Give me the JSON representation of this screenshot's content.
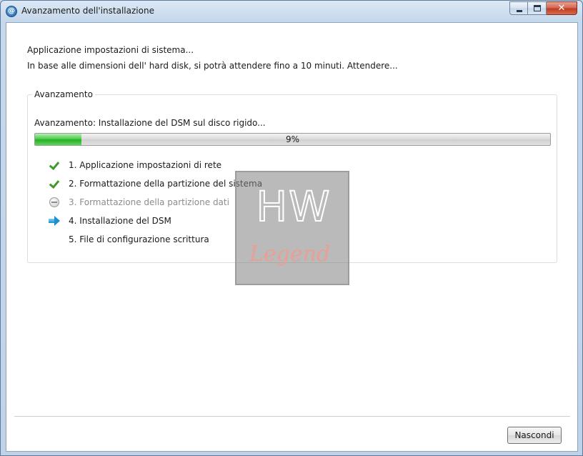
{
  "window": {
    "title": "Avanzamento dell'installazione",
    "close_glyph": "✕"
  },
  "message": {
    "line1": "Applicazione impostazioni di sistema...",
    "line2": "In base alle dimensioni dell' hard disk, si potrà attendere fino a 10 minuti. Attendere..."
  },
  "progress_group": {
    "legend": "Avanzamento",
    "label": "Avanzamento: Installazione del DSM sul disco rigido...",
    "percent_text": "9%",
    "percent_value": 9,
    "fill_color": "#26b026"
  },
  "steps": [
    {
      "label": "1. Applicazione impostazioni di rete",
      "status": "done",
      "icon": "check-icon"
    },
    {
      "label": "2. Formattazione della partizione del sistema",
      "status": "done",
      "icon": "check-icon"
    },
    {
      "label": "3. Formattazione della partizione dati",
      "status": "skipped",
      "icon": "skip-icon"
    },
    {
      "label": "4. Installazione del DSM",
      "status": "current",
      "icon": "arrow-icon"
    },
    {
      "label": "5. File di configurazione scrittura",
      "status": "pending",
      "icon": "none"
    }
  ],
  "watermark": {
    "top_text": "HW",
    "bottom_text": "Legend"
  },
  "footer": {
    "hide_button": "Nascondi"
  }
}
